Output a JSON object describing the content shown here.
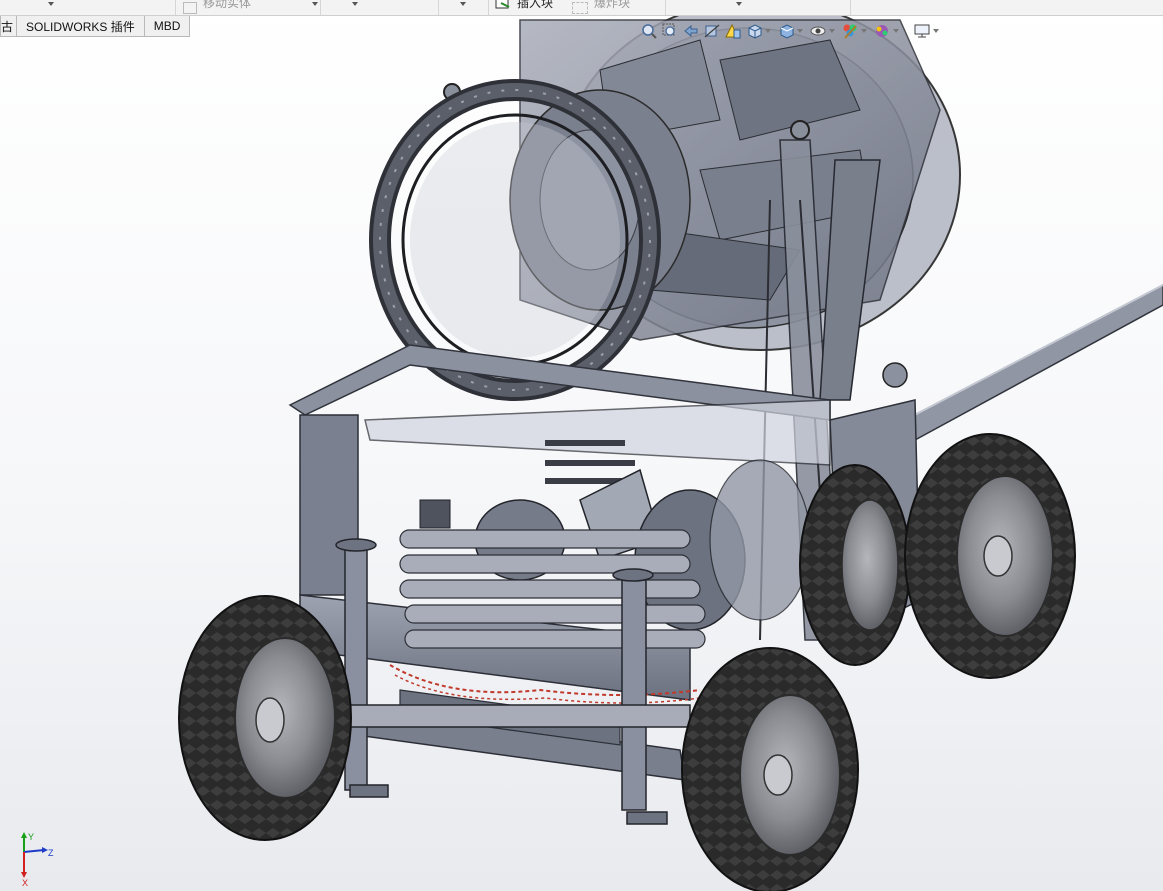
{
  "command_bar": {
    "items": [
      {
        "label": "移动实体",
        "state": "disabled"
      },
      {
        "label": "插入块",
        "state": "enabled"
      },
      {
        "label": "爆炸块",
        "state": "disabled"
      }
    ]
  },
  "tabs": [
    {
      "label": "古",
      "active": false
    },
    {
      "label": "SOLIDWORKS 插件",
      "active": false
    },
    {
      "label": "MBD",
      "active": false
    }
  ],
  "view_toolbar": {
    "icons": [
      "zoom-to-fit-icon",
      "zoom-to-area-icon",
      "previous-view-icon",
      "section-view-icon",
      "dynamic-annotation-icon",
      "view-orientation-icon",
      "display-style-icon",
      "hide-show-items-icon",
      "edit-appearance-icon",
      "apply-scene-icon",
      "view-settings-icon"
    ]
  },
  "triad": {
    "axes": [
      "Y",
      "Z",
      "X"
    ],
    "colors": {
      "x": "#d22020",
      "y": "#19a019",
      "z": "#1e3cc8"
    }
  },
  "model": {
    "description_colors": {
      "body": "#787d8c",
      "body_light": "#9aa0ae",
      "tire": "#2a2a2a",
      "rim": "#8a8c92",
      "glass": "#c8ccd6",
      "wire": "#c0392b"
    }
  }
}
